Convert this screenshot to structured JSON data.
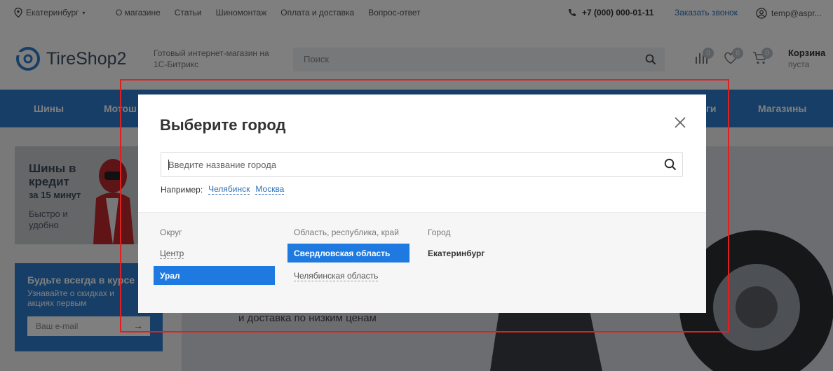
{
  "topbar": {
    "city": "Екатеринбург",
    "nav": [
      "О магазине",
      "Статьи",
      "Шиномонтаж",
      "Оплата и доставка",
      "Вопрос-ответ"
    ],
    "phone": "+7 (000) 000-01-11",
    "callback": "Заказать звонок",
    "user": "temp@aspr..."
  },
  "header": {
    "logo": "TireShop2",
    "slogan": "Готовый интернет-магазин на 1С-Битрикс",
    "search_placeholder": "Поиск",
    "compare_count": "0",
    "favorites_count": "0",
    "cart_count": "0",
    "cart_title": "Корзина",
    "cart_status": "пуста"
  },
  "menu": [
    "Шины",
    "Мотош",
    "ги",
    "Магазины"
  ],
  "page": {
    "banner_title": "Шины в кредит",
    "banner_sub": "за 15 минут",
    "banner_text": "Быстро и удобно",
    "subscribe_title": "Будьте всегда в курсе",
    "subscribe_text": "Узнавайте о скидках и акциях первым",
    "subscribe_placeholder": "Ваш e-mail",
    "hero_text": "и доставка по низким ценам"
  },
  "modal": {
    "title": "Выберите город",
    "input_placeholder": "Введите название города",
    "examples_label": "Например:",
    "examples": [
      "Челябинск",
      "Москва"
    ],
    "columns": {
      "district": {
        "header": "Округ",
        "items": [
          "Центр",
          "Урал"
        ],
        "selected": "Урал"
      },
      "region": {
        "header": "Область, республика, край",
        "items": [
          "Свердловская область",
          "Челябинская область"
        ],
        "selected": "Свердловская область"
      },
      "city": {
        "header": "Город",
        "items": [
          "Екатеринбург"
        ]
      }
    }
  },
  "colors": {
    "accent": "#1e7ae0",
    "menu": "#2f7dcf",
    "link": "#2f6fbb",
    "highlight_border": "#e02020"
  }
}
